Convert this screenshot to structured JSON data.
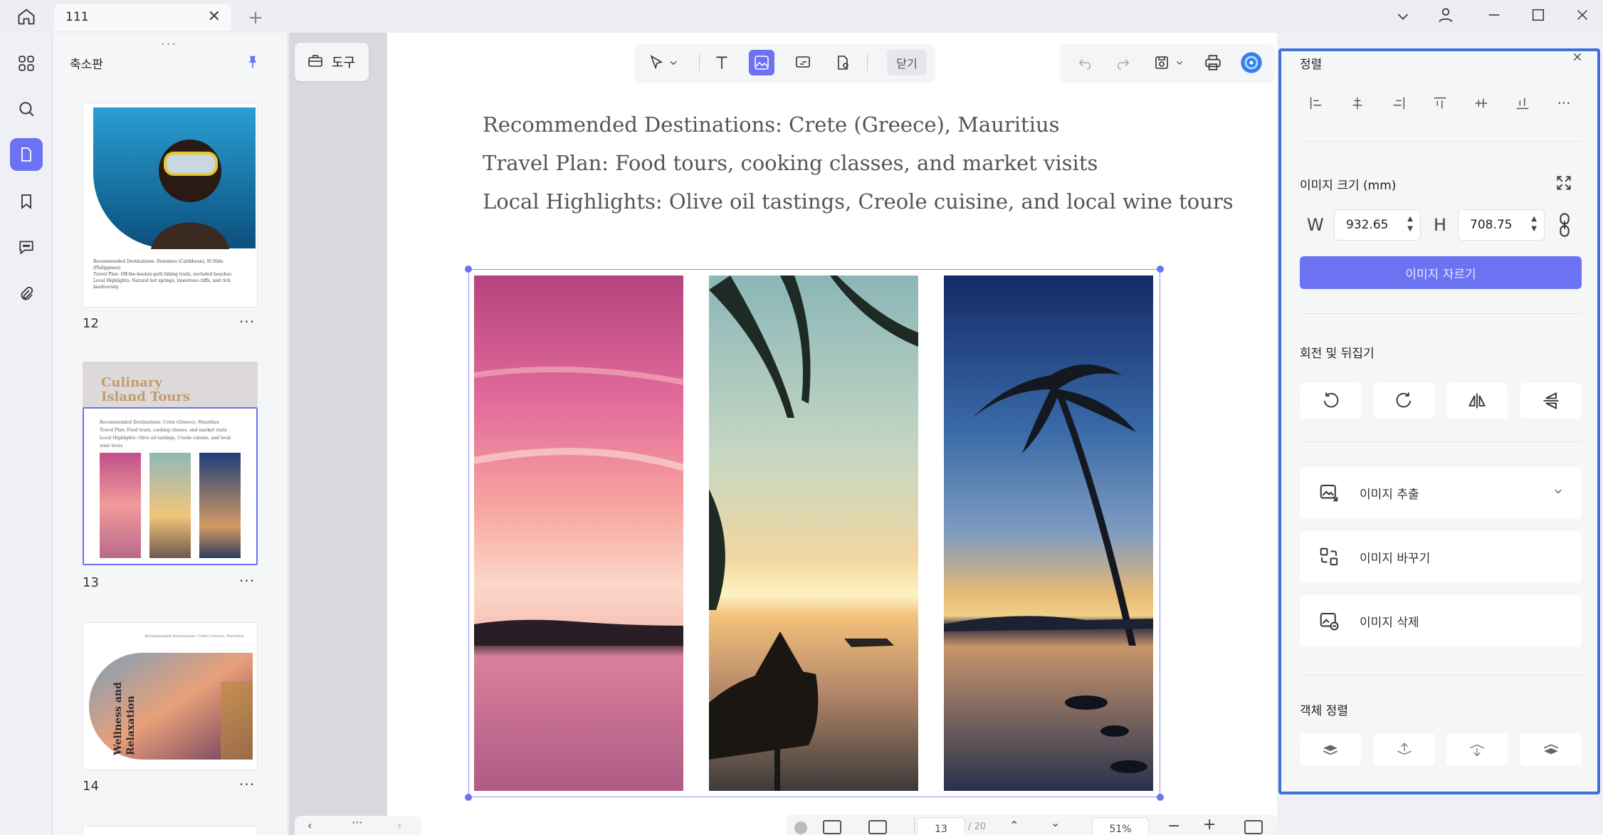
{
  "window": {
    "tab_title": "111"
  },
  "sidebar_panel": {
    "title": "축소판",
    "pages": [
      {
        "number": "12",
        "lines": [
          "Recommended Destinations: Dominica (Caribbean), El Nido (Philippines)",
          "Travel Plan: Off-the-beaten-path hiking trails, secluded beaches",
          "Local Highlights: Natural hot springs, limestone cliffs, and rich biodiversity"
        ]
      },
      {
        "number": "13",
        "heading_line1": "Culinary",
        "heading_line2": "Island Tours",
        "lines": [
          "Recommended Destinations: Crete (Greece), Mauritius",
          "Travel Plan: Food tours, cooking classes, and market visits",
          "Local Highlights: Olive oil tastings, Creole cuisine, and local wine tours"
        ]
      },
      {
        "number": "14",
        "header_line": "Recommended Destinations: Crete (Greece), Mauritius",
        "vertical_title_1": "Wellness and",
        "vertical_title_2": "Relaxation"
      }
    ]
  },
  "toolbar": {
    "tools_label": "도구",
    "close_label": "닫기"
  },
  "document": {
    "line1": "Recommended Destinations: Crete (Greece), Mauritius",
    "line2": "Travel Plan: Food tours, cooking classes, and market visits",
    "line3": "Local Highlights: Olive oil tastings, Creole cuisine, and local wine tours"
  },
  "right_panel": {
    "align_title": "정렬",
    "size_title": "이미지 크기 (mm)",
    "width_label": "W",
    "width_value": "932.65",
    "height_label": "H",
    "height_value": "708.75",
    "crop_label": "이미지 자르기",
    "rotate_title": "회전 및 뒤집기",
    "extract_label": "이미지 추출",
    "replace_label": "이미지 바꾸기",
    "delete_label": "이미지 삭제",
    "arrange_title": "객체 정렬"
  },
  "bottom": {
    "page_input": "13",
    "page_total": "/ 20",
    "zoom": "51%"
  },
  "colors": {
    "accent": "#6b73f2",
    "panel_border": "#3f6fd8"
  }
}
